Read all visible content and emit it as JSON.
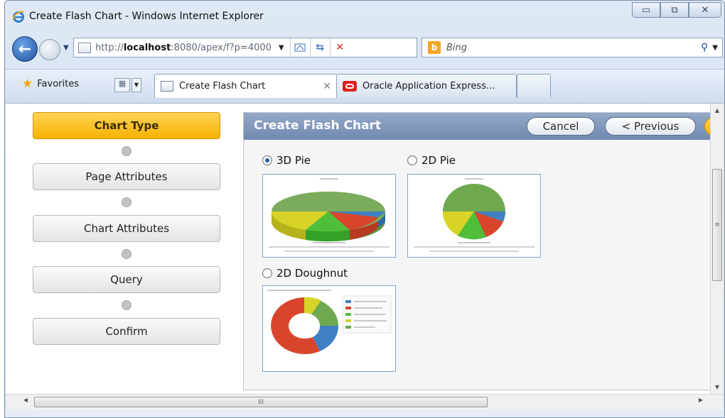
{
  "window": {
    "title": "Create Flash Chart - Windows Internet Explorer",
    "controls": [
      "minimize",
      "maximize",
      "close"
    ]
  },
  "navigation": {
    "address": {
      "prefix": "http://",
      "host": "localhost",
      "path": ":8080/apex/f?p=4000"
    },
    "search": {
      "engine": "Bing",
      "placeholder": "Bing"
    }
  },
  "tabs_bar": {
    "favorites_label": "Favorites",
    "tabs": [
      {
        "label": "Create Flash Chart",
        "active": true
      },
      {
        "label": "Oracle Application Express...",
        "active": false
      }
    ]
  },
  "wizard": {
    "steps": [
      {
        "label": "Chart Type",
        "current": true
      },
      {
        "label": "Page Attributes",
        "current": false
      },
      {
        "label": "Chart Attributes",
        "current": false
      },
      {
        "label": "Query",
        "current": false
      },
      {
        "label": "Confirm",
        "current": false
      }
    ]
  },
  "region": {
    "title": "Create Flash Chart",
    "buttons": {
      "cancel": "Cancel",
      "previous": "< Previous"
    },
    "options": [
      {
        "label": "3D Pie",
        "selected": true,
        "thumbnail_icon": "3d-pie-chart-preview"
      },
      {
        "label": "2D Pie",
        "selected": false,
        "thumbnail_icon": "2d-pie-chart-preview"
      },
      {
        "label": "2D Doughnut",
        "selected": false,
        "thumbnail_icon": "2d-doughnut-chart-preview"
      }
    ]
  },
  "colors": {
    "accent_orange": "#f6b200",
    "region_header": "#7a93b8",
    "pie_green_dark": "#6ea84f",
    "pie_green": "#4fbf3a",
    "pie_yellow": "#d8d427",
    "pie_red": "#d9452c",
    "pie_blue": "#3f7fc4"
  },
  "scrollbars": {
    "vertical_grip": "≡",
    "horizontal_grip": "III"
  }
}
